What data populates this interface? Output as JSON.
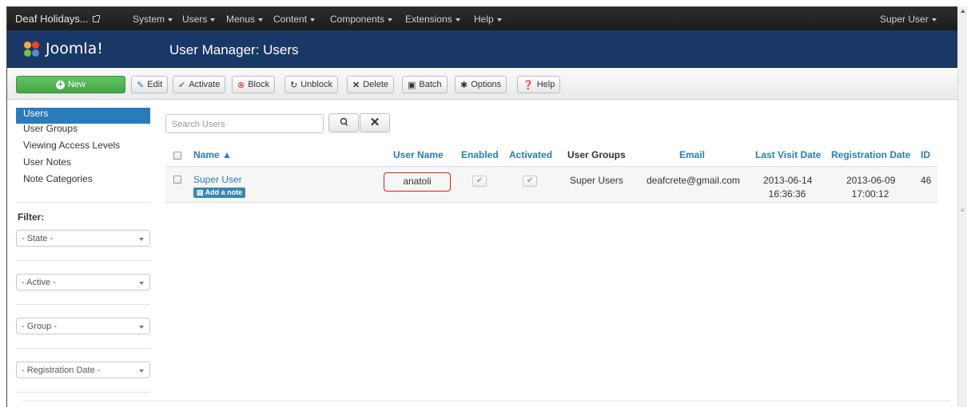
{
  "topbar": {
    "site_name": "Deaf Holidays...",
    "menus": [
      "System",
      "Users",
      "Menus",
      "Content",
      "Components",
      "Extensions",
      "Help"
    ],
    "user_menu": "Super User"
  },
  "header": {
    "logo_text": "Joomla!",
    "page_title": "User Manager: Users"
  },
  "toolbar": {
    "new": "New",
    "edit": "Edit",
    "activate": "Activate",
    "block": "Block",
    "unblock": "Unblock",
    "delete": "Delete",
    "batch": "Batch",
    "options": "Options",
    "help": "Help"
  },
  "sidebar": {
    "items": [
      {
        "label": "Users",
        "active": true
      },
      {
        "label": "User Groups"
      },
      {
        "label": "Viewing Access Levels"
      },
      {
        "label": "User Notes"
      },
      {
        "label": "Note Categories"
      }
    ],
    "filter_title": "Filter:",
    "filters": [
      "- State -",
      "- Active -",
      "- Group -",
      "- Registration Date -"
    ]
  },
  "search": {
    "placeholder": "Search Users"
  },
  "table": {
    "headers": {
      "name": "Name ▲",
      "username": "User Name",
      "enabled": "Enabled",
      "activated": "Activated",
      "groups": "User Groups",
      "email": "Email",
      "last_visit": "Last Visit Date",
      "registration": "Registration Date",
      "id": "ID"
    },
    "rows": [
      {
        "name": "Super User",
        "note_badge": "Add a note",
        "username": "anatoli",
        "enabled": true,
        "activated": true,
        "groups": "Super Users",
        "email": "deafcrete@gmail.com",
        "last_visit_date": "2013-06-14",
        "last_visit_time": "16:36:36",
        "registration_date": "2013-06-09",
        "registration_time": "17:00:12",
        "id": "46"
      }
    ]
  },
  "colors": {
    "topbar": "#1c1c1c",
    "header": "#1a3867",
    "accent": "#2a7bbb",
    "new_button": "#46a546",
    "highlight_box": "#d72020"
  }
}
